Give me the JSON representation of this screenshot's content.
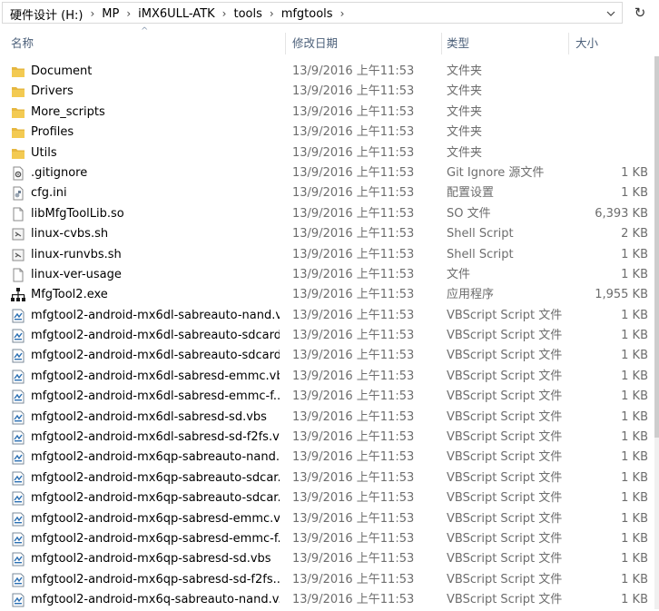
{
  "address": {
    "crumbs": [
      "硬件设计 (H:)",
      "MP",
      "iMX6ULL-ATK",
      "tools",
      "mfgtools"
    ]
  },
  "columns": {
    "name": "名称",
    "date": "修改日期",
    "type": "类型",
    "size": "大小"
  },
  "icons": {
    "folder": "folder-icon",
    "gitignore": "gear-document-icon",
    "ini": "config-file-icon",
    "file": "blank-file-icon",
    "script": "script-file-icon",
    "exe": "application-icon",
    "vbs": "vbscript-file-icon"
  },
  "colors": {
    "folder": "#e6b740",
    "header_text": "#4c607a",
    "meta_text": "#6d6d6d"
  },
  "files": [
    {
      "name": "Document",
      "date": "13/9/2016 上午11:53",
      "type": "文件夹",
      "size": "",
      "icon": "folder"
    },
    {
      "name": "Drivers",
      "date": "13/9/2016 上午11:53",
      "type": "文件夹",
      "size": "",
      "icon": "folder"
    },
    {
      "name": "More_scripts",
      "date": "13/9/2016 上午11:53",
      "type": "文件夹",
      "size": "",
      "icon": "folder"
    },
    {
      "name": "Profiles",
      "date": "13/9/2016 上午11:53",
      "type": "文件夹",
      "size": "",
      "icon": "folder"
    },
    {
      "name": "Utils",
      "date": "13/9/2016 上午11:53",
      "type": "文件夹",
      "size": "",
      "icon": "folder"
    },
    {
      "name": ".gitignore",
      "date": "13/9/2016 上午11:53",
      "type": "Git Ignore 源文件",
      "size": "1 KB",
      "icon": "gitignore"
    },
    {
      "name": "cfg.ini",
      "date": "13/9/2016 上午11:53",
      "type": "配置设置",
      "size": "1 KB",
      "icon": "ini"
    },
    {
      "name": "libMfgToolLib.so",
      "date": "13/9/2016 上午11:53",
      "type": "SO 文件",
      "size": "6,393 KB",
      "icon": "file"
    },
    {
      "name": "linux-cvbs.sh",
      "date": "13/9/2016 上午11:53",
      "type": "Shell Script",
      "size": "2 KB",
      "icon": "script"
    },
    {
      "name": "linux-runvbs.sh",
      "date": "13/9/2016 上午11:53",
      "type": "Shell Script",
      "size": "1 KB",
      "icon": "script"
    },
    {
      "name": "linux-ver-usage",
      "date": "13/9/2016 上午11:53",
      "type": "文件",
      "size": "1 KB",
      "icon": "file"
    },
    {
      "name": "MfgTool2.exe",
      "date": "13/9/2016 上午11:53",
      "type": "应用程序",
      "size": "1,955 KB",
      "icon": "exe"
    },
    {
      "name": "mfgtool2-android-mx6dl-sabreauto-nand.v...",
      "date": "13/9/2016 上午11:53",
      "type": "VBScript Script 文件",
      "size": "1 KB",
      "icon": "vbs"
    },
    {
      "name": "mfgtool2-android-mx6dl-sabreauto-sdcard...",
      "date": "13/9/2016 上午11:53",
      "type": "VBScript Script 文件",
      "size": "1 KB",
      "icon": "vbs"
    },
    {
      "name": "mfgtool2-android-mx6dl-sabreauto-sdcard...",
      "date": "13/9/2016 上午11:53",
      "type": "VBScript Script 文件",
      "size": "1 KB",
      "icon": "vbs"
    },
    {
      "name": "mfgtool2-android-mx6dl-sabresd-emmc.vbs",
      "date": "13/9/2016 上午11:53",
      "type": "VBScript Script 文件",
      "size": "1 KB",
      "icon": "vbs"
    },
    {
      "name": "mfgtool2-android-mx6dl-sabresd-emmc-f...",
      "date": "13/9/2016 上午11:53",
      "type": "VBScript Script 文件",
      "size": "1 KB",
      "icon": "vbs"
    },
    {
      "name": "mfgtool2-android-mx6dl-sabresd-sd.vbs",
      "date": "13/9/2016 上午11:53",
      "type": "VBScript Script 文件",
      "size": "1 KB",
      "icon": "vbs"
    },
    {
      "name": "mfgtool2-android-mx6dl-sabresd-sd-f2fs.v...",
      "date": "13/9/2016 上午11:53",
      "type": "VBScript Script 文件",
      "size": "1 KB",
      "icon": "vbs"
    },
    {
      "name": "mfgtool2-android-mx6qp-sabreauto-nand....",
      "date": "13/9/2016 上午11:53",
      "type": "VBScript Script 文件",
      "size": "1 KB",
      "icon": "vbs"
    },
    {
      "name": "mfgtool2-android-mx6qp-sabreauto-sdcar...",
      "date": "13/9/2016 上午11:53",
      "type": "VBScript Script 文件",
      "size": "1 KB",
      "icon": "vbs"
    },
    {
      "name": "mfgtool2-android-mx6qp-sabreauto-sdcar...",
      "date": "13/9/2016 上午11:53",
      "type": "VBScript Script 文件",
      "size": "1 KB",
      "icon": "vbs"
    },
    {
      "name": "mfgtool2-android-mx6qp-sabresd-emmc.v...",
      "date": "13/9/2016 上午11:53",
      "type": "VBScript Script 文件",
      "size": "1 KB",
      "icon": "vbs"
    },
    {
      "name": "mfgtool2-android-mx6qp-sabresd-emmc-f...",
      "date": "13/9/2016 上午11:53",
      "type": "VBScript Script 文件",
      "size": "1 KB",
      "icon": "vbs"
    },
    {
      "name": "mfgtool2-android-mx6qp-sabresd-sd.vbs",
      "date": "13/9/2016 上午11:53",
      "type": "VBScript Script 文件",
      "size": "1 KB",
      "icon": "vbs"
    },
    {
      "name": "mfgtool2-android-mx6qp-sabresd-sd-f2fs....",
      "date": "13/9/2016 上午11:53",
      "type": "VBScript Script 文件",
      "size": "1 KB",
      "icon": "vbs"
    },
    {
      "name": "mfgtool2-android-mx6q-sabreauto-nand.v...",
      "date": "13/9/2016 上午11:53",
      "type": "VBScript Script 文件",
      "size": "1 KB",
      "icon": "vbs"
    }
  ]
}
